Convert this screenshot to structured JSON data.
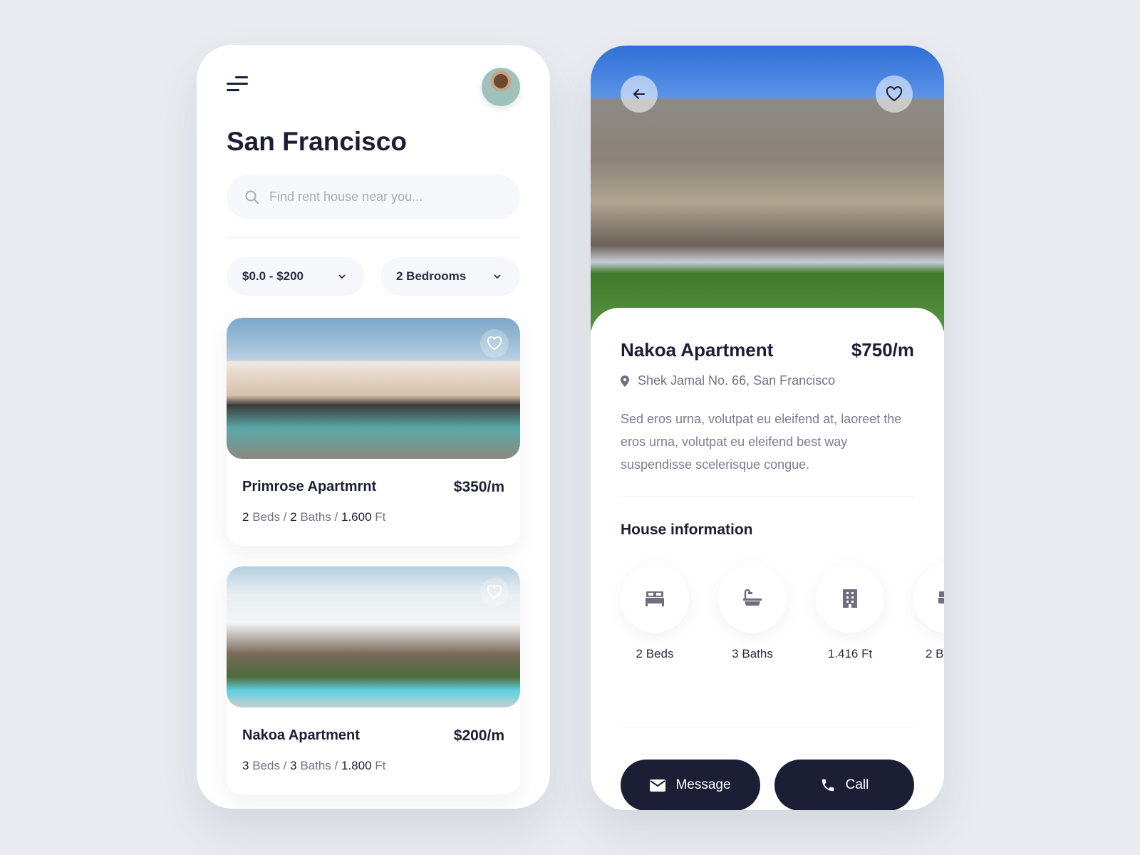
{
  "list_screen": {
    "title": "San Francisco",
    "search_placeholder": "Find rent house near you...",
    "filters": [
      {
        "label": "$0.0 - $200"
      },
      {
        "label": "2 Bedrooms"
      }
    ],
    "listings": [
      {
        "name": "Primrose Apartmrnt",
        "price": "$350/m",
        "beds": "2",
        "beds_label": "Beds",
        "baths": "2",
        "baths_label": "Baths",
        "area": "1.600",
        "area_unit": "Ft"
      },
      {
        "name": "Nakoa Apartment",
        "price": "$200/m",
        "beds": "3",
        "beds_label": "Beds",
        "baths": "3",
        "baths_label": "Baths",
        "area": "1.800",
        "area_unit": "Ft"
      }
    ]
  },
  "detail_screen": {
    "name": "Nakoa Apartment",
    "price": "$750/m",
    "address": "Shek Jamal No. 66, San Francisco",
    "description": "Sed eros urna, volutpat eu eleifend at, laoreet the eros urna, volutpat eu eleifend best way suspendisse scelerisque congue.",
    "section_title": "House information",
    "features": [
      {
        "label": "2 Beds",
        "icon": "bed-icon"
      },
      {
        "label": "3 Baths",
        "icon": "bathtub-icon"
      },
      {
        "label": "1.416 Ft",
        "icon": "building-icon"
      },
      {
        "label": "2 B",
        "icon": "bed-icon"
      }
    ],
    "message_label": "Message",
    "call_label": "Call"
  },
  "colors": {
    "primary": "#1c1e36",
    "background": "#e9ebf0",
    "icon": "#6f6e80"
  }
}
